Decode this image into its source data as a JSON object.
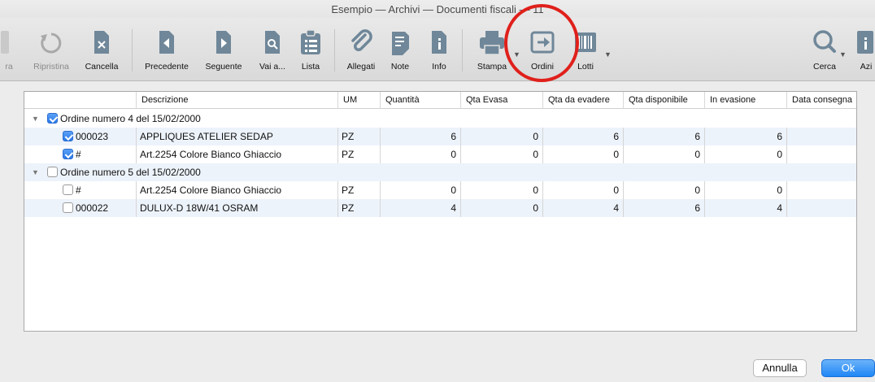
{
  "window": {
    "title": "Esempio — Archivi — Documenti fiscali — 11"
  },
  "toolbar": {
    "partial_left_label": "ra",
    "ripristina": "Ripristina",
    "cancella": "Cancella",
    "precedente": "Precedente",
    "seguente": "Seguente",
    "vai": "Vai a...",
    "lista": "Lista",
    "allegati": "Allegati",
    "note": "Note",
    "info": "Info",
    "stampa": "Stampa",
    "ordini": "Ordini",
    "lotti": "Lotti",
    "cerca": "Cerca",
    "azioni_partial": "Azi"
  },
  "table": {
    "headers": {
      "descrizione": "Descrizione",
      "um": "UM",
      "quantita": "Quantità",
      "qta_evasa": "Qta Evasa",
      "qta_da_evadere": "Qta da evadere",
      "qta_disponibile": "Qta disponibile",
      "in_evasione": "In evasione",
      "data_consegna": "Data consegna"
    },
    "groups": [
      {
        "label": "Ordine numero 4 del 15/02/2000",
        "checked": true
      },
      {
        "label": "Ordine numero 5 del 15/02/2000",
        "checked": false
      }
    ],
    "rows": [
      {
        "code": "000023",
        "checked": true,
        "descrizione": "APPLIQUES ATELIER SEDAP",
        "um": "PZ",
        "quantita": "6",
        "qta_evasa": "0",
        "qta_da_evadere": "6",
        "qta_disponibile": "6",
        "in_evasione": "6",
        "data_consegna": ""
      },
      {
        "code": "#",
        "checked": true,
        "descrizione": "Art.2254 Colore Bianco Ghiaccio",
        "um": "PZ",
        "quantita": "0",
        "qta_evasa": "0",
        "qta_da_evadere": "0",
        "qta_disponibile": "0",
        "in_evasione": "0",
        "data_consegna": ""
      },
      {
        "code": "#",
        "checked": false,
        "descrizione": "Art.2254 Colore Bianco Ghiaccio",
        "um": "PZ",
        "quantita": "0",
        "qta_evasa": "0",
        "qta_da_evadere": "0",
        "qta_disponibile": "0",
        "in_evasione": "0",
        "data_consegna": ""
      },
      {
        "code": "000022",
        "checked": false,
        "descrizione": "DULUX-D 18W/41 OSRAM",
        "um": "PZ",
        "quantita": "4",
        "qta_evasa": "0",
        "qta_da_evadere": "4",
        "qta_disponibile": "6",
        "in_evasione": "4",
        "data_consegna": ""
      }
    ]
  },
  "buttons": {
    "annulla": "Annulla",
    "ok": "Ok"
  },
  "colors": {
    "highlight_circle": "#e0201b",
    "ok_button": "#1f86f5",
    "checkbox_on": "#2a79e8",
    "row_alt": "#edf3fb"
  }
}
